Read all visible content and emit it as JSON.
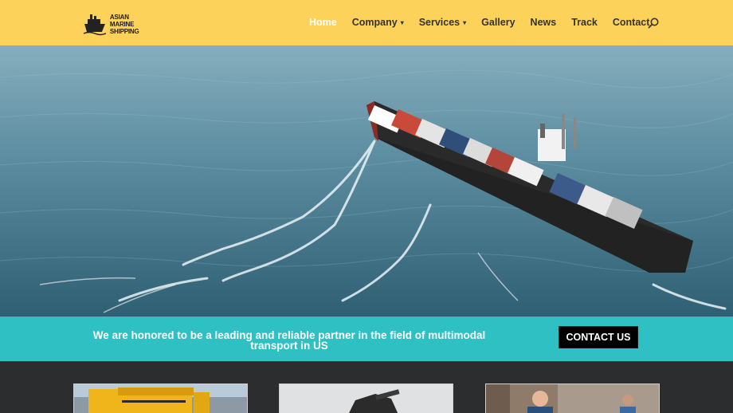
{
  "brand": {
    "logo_line1": "ASIAN MARINE",
    "logo_line2": "SHIPPING",
    "icon": "ship-icon"
  },
  "nav": {
    "items": [
      {
        "label": "Home",
        "active": true,
        "dropdown": false
      },
      {
        "label": "Company",
        "active": false,
        "dropdown": true
      },
      {
        "label": "Services",
        "active": false,
        "dropdown": true
      },
      {
        "label": "Gallery",
        "active": false,
        "dropdown": false
      },
      {
        "label": "News",
        "active": false,
        "dropdown": false
      },
      {
        "label": "Track",
        "active": false,
        "dropdown": false
      },
      {
        "label": "Contact",
        "active": false,
        "dropdown": false
      }
    ],
    "chevron": "▾",
    "search_icon": "search-icon"
  },
  "hero": {
    "image": "container ship at sea"
  },
  "cta": {
    "text": "We are honored to be a leading and reliable partner in the field of multimodal transport in US",
    "button_label": "CONTACT US"
  },
  "cards": [
    {
      "image": "yellow truck"
    },
    {
      "image": "excavator"
    },
    {
      "image": "warehouse workers"
    }
  ],
  "colors": {
    "header_bg": "#fcd25b",
    "cta_bg": "#2fc0c3",
    "button_bg": "#000000",
    "dark_bg": "#2b2d2f",
    "nav_active": "#ffffff",
    "nav_text": "#333333"
  }
}
